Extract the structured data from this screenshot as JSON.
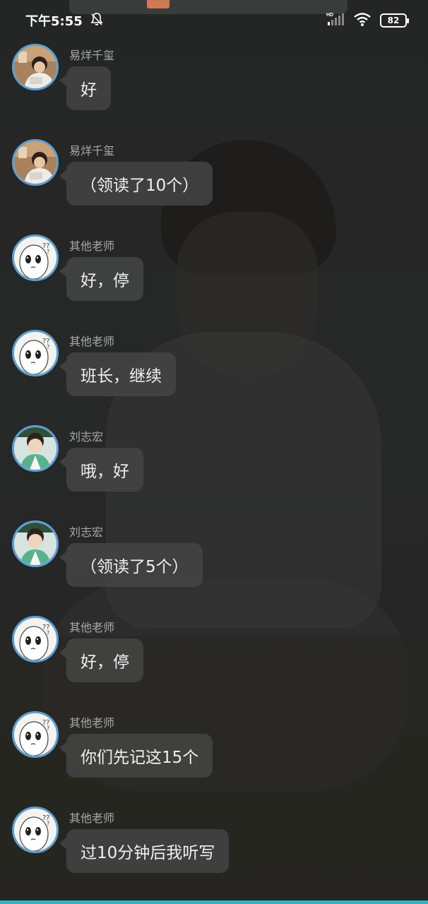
{
  "status_bar": {
    "time": "下午5:55",
    "network_badge": "HD",
    "battery": "82",
    "icons": [
      "mute-bell-icon",
      "signal-icon",
      "wifi-icon",
      "battery-icon"
    ]
  },
  "messages": [
    {
      "sender": "易烊千玺",
      "text": "好",
      "avatar": "boy-photo"
    },
    {
      "sender": "易烊千玺",
      "text": "（领读了10个）",
      "avatar": "boy-photo"
    },
    {
      "sender": "其他老师",
      "text": "好，停",
      "avatar": "cartoon-face"
    },
    {
      "sender": "其他老师",
      "text": "班长，继续",
      "avatar": "cartoon-face"
    },
    {
      "sender": "刘志宏",
      "text": "哦，好",
      "avatar": "boy-photo-green"
    },
    {
      "sender": "刘志宏",
      "text": "（领读了5个）",
      "avatar": "boy-photo-green"
    },
    {
      "sender": "其他老师",
      "text": "好，停",
      "avatar": "cartoon-face"
    },
    {
      "sender": "其他老师",
      "text": "你们先记这15个",
      "avatar": "cartoon-face"
    },
    {
      "sender": "其他老师",
      "text": "过10分钟后我听写",
      "avatar": "cartoon-face"
    }
  ],
  "colors": {
    "background": "#2b2c2c",
    "bubble": "#464646",
    "avatar_ring": "#5d9fd0",
    "bottom_accent": "#2bb3c9"
  }
}
